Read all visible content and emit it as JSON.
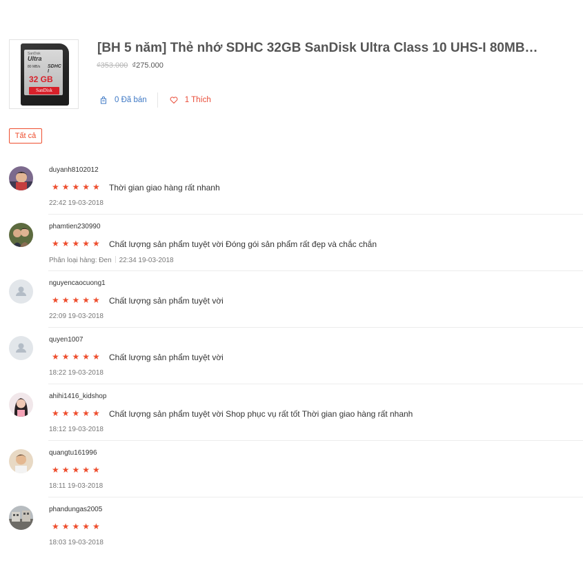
{
  "product": {
    "title": "[BH 5 năm] Thẻ nhớ SDHC 32GB SanDisk Ultra Class 10 UHS-I 80MB…",
    "old_price": "₫353.000",
    "new_price": "₫275.000",
    "sold_label": "0 Đã bán",
    "like_label": "1 Thích",
    "image_text": {
      "small": "SanDisk",
      "ultra": "Ultra",
      "speed": "80 MB/s",
      "hc": "SDHC I",
      "capacity": "32 GB",
      "brand": "SanDisk"
    }
  },
  "filter": {
    "label": "Tất cả"
  },
  "reviews": [
    {
      "username": "duyanh8102012",
      "stars": "★★★★★",
      "comment": "Thời gian giao hàng rất nhanh",
      "time": "22:42 19-03-2018",
      "variant": "",
      "avatar_type": "photo-child"
    },
    {
      "username": "phamtien230990",
      "stars": "★★★★★",
      "comment": "Chất lượng sản phẩm tuyệt vời Đóng gói sản phẩm rất đẹp và chắc chắn",
      "time": "22:34 19-03-2018",
      "variant": "Phân loại hàng: Đen",
      "avatar_type": "photo-couple"
    },
    {
      "username": "nguyencaocuong1",
      "stars": "★★★★★",
      "comment": "Chất lượng sản phẩm tuyệt vời",
      "time": "22:09 19-03-2018",
      "variant": "",
      "avatar_type": "default"
    },
    {
      "username": "quyen1007",
      "stars": "★★★★★",
      "comment": "Chất lượng sản phẩm tuyệt vời",
      "time": "18:22 19-03-2018",
      "variant": "",
      "avatar_type": "default"
    },
    {
      "username": "ahihi1416_kidshop",
      "stars": "★★★★★",
      "comment": "Chất lượng sản phẩm tuyệt vời Shop phục vụ rất tốt Thời gian giao hàng rất nhanh",
      "time": "18:12 19-03-2018",
      "variant": "",
      "avatar_type": "photo-girl"
    },
    {
      "username": "quangtu161996",
      "stars": "★★★★★",
      "comment": "",
      "time": "18:11 19-03-2018",
      "variant": "",
      "avatar_type": "photo-boy"
    },
    {
      "username": "phandungas2005",
      "stars": "★★★★★",
      "comment": "",
      "time": "18:03 19-03-2018",
      "variant": "",
      "avatar_type": "photo-building"
    }
  ],
  "colors": {
    "accent": "#ee4d2d",
    "link_blue": "#3f79c5",
    "separator": "#ececec"
  }
}
